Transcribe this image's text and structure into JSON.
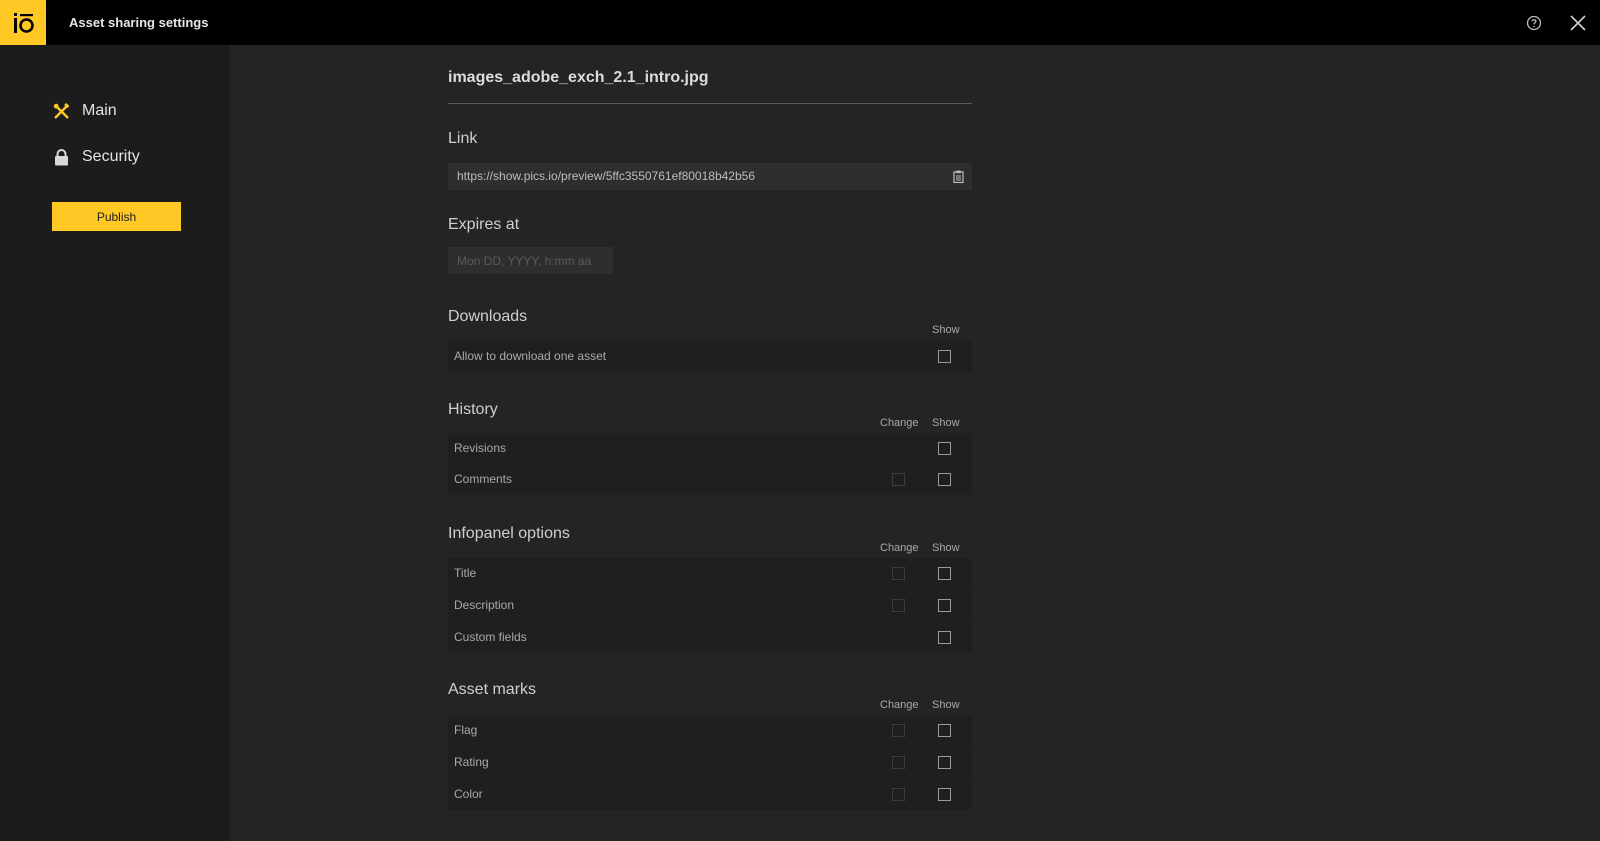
{
  "header": {
    "title": "Asset sharing settings",
    "logo_text": "iO",
    "brand_color": "#ffc824",
    "help_icon": "help-circle-icon",
    "close_icon": "close-icon"
  },
  "sidebar": {
    "items": [
      {
        "label": "Main",
        "icon": "tools-icon",
        "active": true
      },
      {
        "label": "Security",
        "icon": "lock-icon",
        "active": false
      }
    ],
    "publish_label": "Publish"
  },
  "main": {
    "file_name": "images_adobe_exch_2.1_intro.jpg",
    "link": {
      "label": "Link",
      "url": "https://show.pics.io/preview/5ffc3550761ef80018b42b56",
      "copy_icon": "clipboard-icon"
    },
    "expires": {
      "label": "Expires at",
      "placeholder": "Mon DD, YYYY, h:mm aa",
      "value": ""
    },
    "downloads": {
      "label": "Downloads",
      "show_header": "Show",
      "rows": [
        {
          "label": "Allow to download one asset",
          "show": false
        }
      ]
    },
    "history": {
      "label": "History",
      "change_header": "Change",
      "show_header": "Show",
      "rows": [
        {
          "label": "Revisions",
          "change": null,
          "show": false
        },
        {
          "label": "Comments",
          "change": false,
          "show": false
        }
      ]
    },
    "infopanel": {
      "label": "Infopanel options",
      "change_header": "Change",
      "show_header": "Show",
      "rows": [
        {
          "label": "Title",
          "change": false,
          "show": false
        },
        {
          "label": "Description",
          "change": false,
          "show": false
        },
        {
          "label": "Custom fields",
          "change": null,
          "show": false
        }
      ]
    },
    "asset_marks": {
      "label": "Asset marks",
      "change_header": "Change",
      "show_header": "Show",
      "rows": [
        {
          "label": "Flag",
          "change": false,
          "show": false
        },
        {
          "label": "Rating",
          "change": false,
          "show": false
        },
        {
          "label": "Color",
          "change": false,
          "show": false
        }
      ]
    }
  }
}
